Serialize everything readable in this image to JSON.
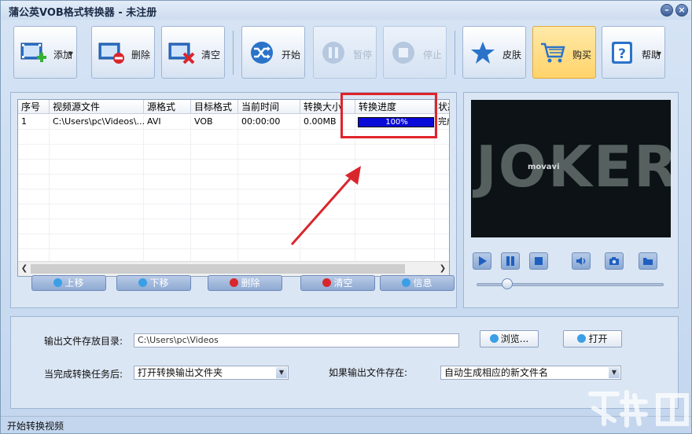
{
  "window": {
    "title": "蒲公英VOB格式转换器 - 未注册",
    "accent": "#3d5f9a"
  },
  "toolbar": {
    "add": "添加",
    "delete": "删除",
    "clear": "清空",
    "start": "开始",
    "pause": "暂停",
    "stop": "停止",
    "skin": "皮肤",
    "buy": "购买",
    "help": "帮助"
  },
  "table": {
    "headers": [
      "序号",
      "视频源文件",
      "源格式",
      "目标格式",
      "当前时间",
      "转换大小",
      "转换进度",
      "状态"
    ],
    "rows": [
      {
        "index": "1",
        "source": "C:\\Users\\pc\\Videos\\...",
        "src_format": "AVI",
        "dst_format": "VOB",
        "time": "00:00:00",
        "size": "0.00MB",
        "progress_text": "100%",
        "progress": 1.0,
        "status": "完成"
      }
    ]
  },
  "list_buttons": {
    "up": "上移",
    "down": "下移",
    "remove": "删除",
    "clear": "清空",
    "info": "信息"
  },
  "preview": {
    "poster_title": "JOKER",
    "watermark": "movavi"
  },
  "output": {
    "dir_label": "输出文件存放目录:",
    "dir_value": "C:\\Users\\pc\\Videos",
    "browse": "浏览...",
    "open": "打开",
    "after_label": "当完成转换任务后:",
    "after_value": "打开转换输出文件夹",
    "exists_label": "如果输出文件存在:",
    "exists_value": "自动生成相应的新文件名"
  },
  "status": {
    "text": "开始转换视频"
  }
}
